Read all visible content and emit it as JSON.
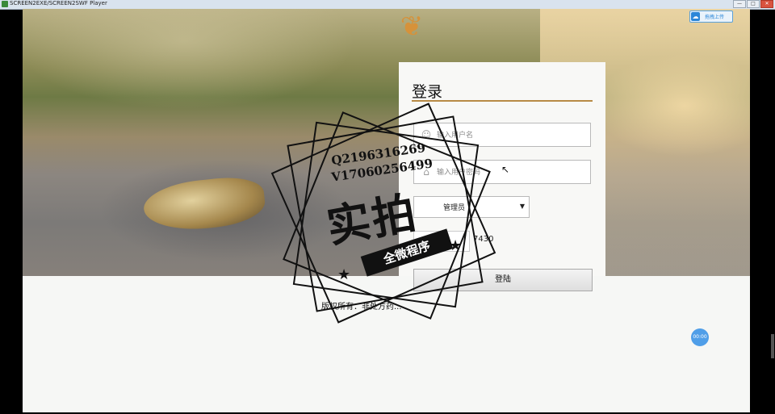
{
  "window": {
    "title": "SCREEN2EXE/SCREEN2SWF Player",
    "min": "—",
    "max": "□",
    "close": "✕"
  },
  "toolbar": {
    "upload_label": "拖拽上传"
  },
  "login": {
    "title": "登录",
    "username_placeholder": "输入用户名",
    "password_placeholder": "输入用户密码",
    "role_value": "管理员",
    "captcha_code": "7430",
    "submit_label": "登陆"
  },
  "footer": {
    "copyright": "版权所有：非处方药..."
  },
  "player": {
    "timer": "00:00"
  },
  "watermark": {
    "qq": "Q2196316269",
    "wx": "V17060256499",
    "headline": "实拍",
    "ribbon": "全微程序"
  }
}
